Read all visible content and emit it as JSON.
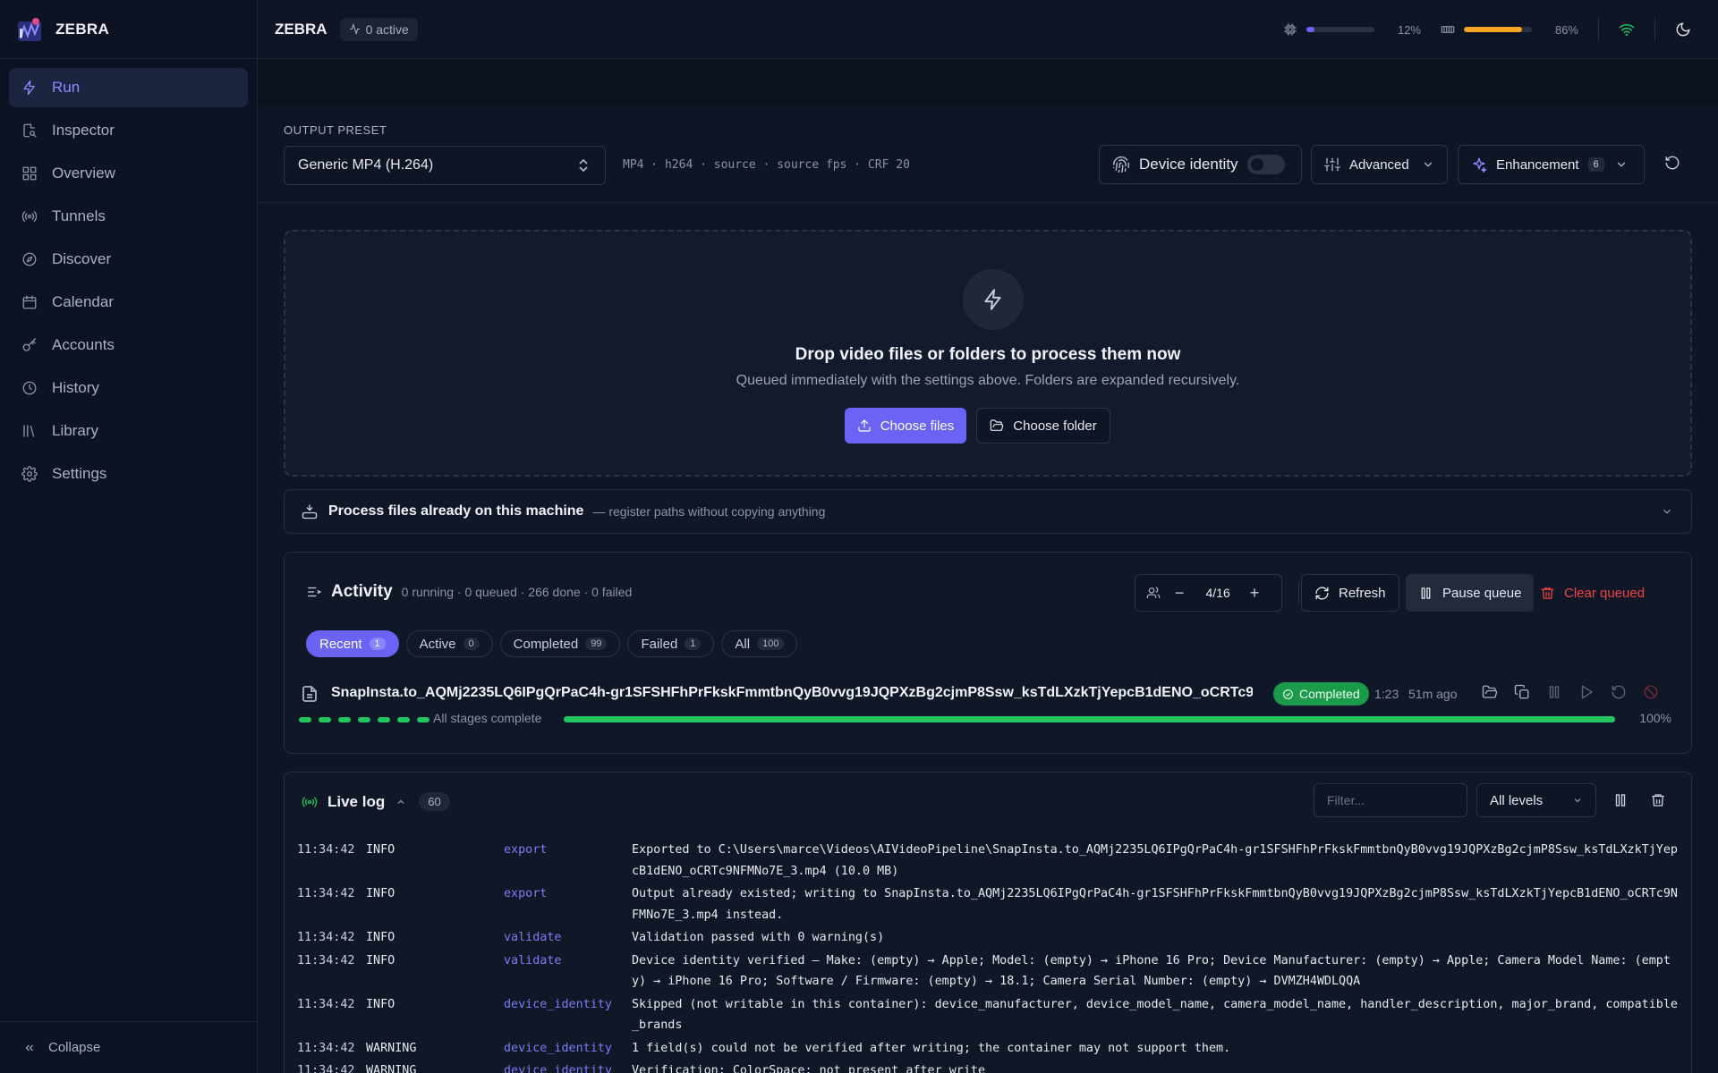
{
  "app": {
    "name": "ZEBRA"
  },
  "sidebar": {
    "items": [
      {
        "label": "Run",
        "icon": "bolt-icon",
        "active": true
      },
      {
        "label": "Inspector",
        "icon": "file-search-icon"
      },
      {
        "label": "Overview",
        "icon": "grid-icon"
      },
      {
        "label": "Tunnels",
        "icon": "radio-icon"
      },
      {
        "label": "Discover",
        "icon": "compass-icon"
      },
      {
        "label": "Calendar",
        "icon": "calendar-icon"
      },
      {
        "label": "Accounts",
        "icon": "key-icon"
      },
      {
        "label": "History",
        "icon": "clock-icon"
      },
      {
        "label": "Library",
        "icon": "library-icon"
      },
      {
        "label": "Settings",
        "icon": "gear-icon"
      }
    ],
    "collapse_label": "Collapse"
  },
  "topbar": {
    "title": "ZEBRA",
    "active_label": "0 active",
    "cpu": {
      "value": 0.12,
      "label": "12%",
      "color": "#6a63f5"
    },
    "mem": {
      "value": 0.86,
      "label": "86%",
      "color": "#f5a524"
    }
  },
  "preset": {
    "label": "OUTPUT PRESET",
    "value": "Generic MP4 (H.264)",
    "summary": "MP4 · h264 · source · source fps · CRF 20",
    "device_identity_label": "Device identity",
    "advanced_label": "Advanced",
    "enhancement_label": "Enhancement",
    "enhancement_count": "6"
  },
  "dropzone": {
    "title": "Drop video files or folders to process them now",
    "subtitle": "Queued immediately with the settings above. Folders are expanded recursively.",
    "choose_files": "Choose files",
    "choose_folder": "Choose folder"
  },
  "process": {
    "title": "Process files already on this machine",
    "subtitle": "— register paths without copying anything"
  },
  "activity": {
    "title": "Activity",
    "stats": "0 running · 0 queued · 266 done · 0 failed",
    "concurrency": "4/16",
    "refresh_label": "Refresh",
    "pause_label": "Pause queue",
    "clear_label": "Clear queued",
    "tabs": [
      {
        "label": "Recent",
        "count": "1",
        "active": true
      },
      {
        "label": "Active",
        "count": "0"
      },
      {
        "label": "Completed",
        "count": "99"
      },
      {
        "label": "Failed",
        "count": "1"
      },
      {
        "label": "All",
        "count": "100"
      }
    ],
    "job": {
      "name": "SnapInsta.to_AQMj2235LQ6IPgQrPaC4h-gr1SFSHFhPrFkskFmmtbnQyB0vvg19JQPXzBg2cjmP8Ssw_ksTdLXzkTjYepcB1dENO_oCRTc9NF...",
      "status": "Completed",
      "duration": "1:23",
      "ago": "51m ago",
      "stage_text": "All stages complete",
      "progress": 1.0,
      "progress_label": "100%",
      "stages_done": 7
    }
  },
  "livelog": {
    "title": "Live log",
    "count": "60",
    "filter_placeholder": "Filter...",
    "level_value": "All levels",
    "lines": [
      {
        "time": "11:34:42",
        "level": "INFO",
        "source": "export",
        "message": "Exported to C:\\Users\\marce\\Videos\\AIVideoPipeline\\SnapInsta.to_AQMj2235LQ6IPgQrPaC4h-gr1SFSHFhPrFkskFmmtbnQyB0vvg19JQPXzBg2cjmP8Ssw_ksTdLXzkTjYepcB1dENO_oCRTc9NFMNo7E_3.mp4 (10.0 MB)"
      },
      {
        "time": "11:34:42",
        "level": "INFO",
        "source": "export",
        "message": "Output already existed; writing to SnapInsta.to_AQMj2235LQ6IPgQrPaC4h-gr1SFSHFhPrFkskFmmtbnQyB0vvg19JQPXzBg2cjmP8Ssw_ksTdLXzkTjYepcB1dENO_oCRTc9NFMNo7E_3.mp4 instead."
      },
      {
        "time": "11:34:42",
        "level": "INFO",
        "source": "validate",
        "message": "Validation passed with 0 warning(s)"
      },
      {
        "time": "11:34:42",
        "level": "INFO",
        "source": "validate",
        "message": "Device identity verified — Make: (empty) → Apple; Model: (empty) → iPhone 16 Pro; Device Manufacturer: (empty) → Apple; Camera Model Name: (empty) → iPhone 16 Pro; Software / Firmware: (empty) → 18.1; Camera Serial Number: (empty) → DVMZH4WDLQQA"
      },
      {
        "time": "11:34:42",
        "level": "INFO",
        "source": "device_identity",
        "message": "Skipped (not writable in this container): device_manufacturer, device_model_name, camera_model_name, handler_description, major_brand, compatible_brands"
      },
      {
        "time": "11:34:42",
        "level": "WARNING",
        "source": "device_identity",
        "message": "1 field(s) could not be verified after writing; the container may not support them."
      },
      {
        "time": "11:34:42",
        "level": "WARNING",
        "source": "device_identity",
        "message": "Verification: ColorSpace: not present after write"
      }
    ]
  }
}
